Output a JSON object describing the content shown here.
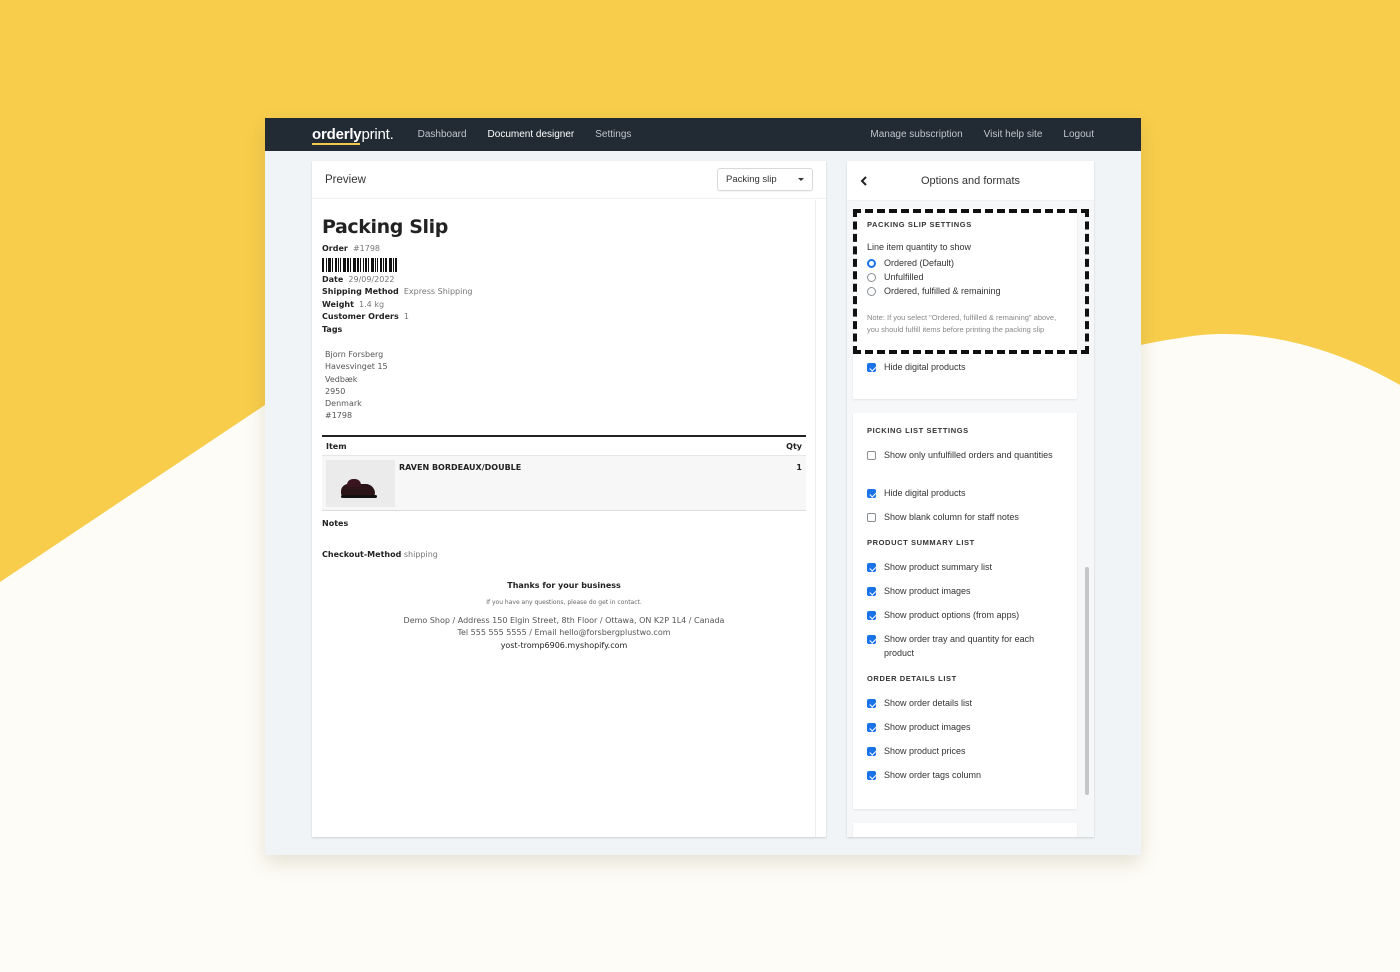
{
  "nav": {
    "logo_first": "orderly",
    "logo_second": "print.",
    "links": [
      "Dashboard",
      "Document designer",
      "Settings"
    ],
    "active_link": "Document designer",
    "right_links": [
      "Manage subscription",
      "Visit help site",
      "Logout"
    ]
  },
  "preview": {
    "title": "Preview",
    "document_type_select": "Packing slip"
  },
  "slip": {
    "heading": "Packing Slip",
    "order_label": "Order",
    "order_value": "#1798",
    "date_label": "Date",
    "date_value": "29/09/2022",
    "shipping_label": "Shipping Method",
    "shipping_value": "Express Shipping",
    "weight_label": "Weight",
    "weight_value": "1.4 kg",
    "customer_orders_label": "Customer Orders",
    "customer_orders_value": "1",
    "tags_label": "Tags",
    "address": [
      "Bjorn Forsberg",
      "Havesvinget 15",
      "Vedbæk",
      "2950",
      "Denmark",
      "#1798"
    ],
    "table_headers": {
      "item": "Item",
      "qty": "Qty"
    },
    "items": [
      {
        "name": "RAVEN BORDEAUX/DOUBLE",
        "qty": "1",
        "image": "shoe-image"
      }
    ],
    "notes_label": "Notes",
    "checkout_label": "Checkout-Method",
    "checkout_value": "shipping",
    "footer_thanks": "Thanks for your business",
    "footer_questions": "If you have any questions, please do get in contact.",
    "footer_address": "Demo Shop / Address 150 Elgin Street, 8th Floor / Ottawa, ON K2P 1L4 / Canada",
    "footer_contact": "Tel 555 555 5555 / Email hello@forsbergplustwo.com",
    "footer_domain": "yost-tromp6906.myshopify.com"
  },
  "options": {
    "title": "Options and formats",
    "packing_slip": {
      "section_title": "PACKING SLIP SETTINGS",
      "quantity_label": "Line item quantity to show",
      "radio_options": [
        {
          "label": "Ordered (Default)",
          "selected": true
        },
        {
          "label": "Unfulfilled",
          "selected": false
        },
        {
          "label": "Ordered, fulfilled & remaining",
          "selected": false
        }
      ],
      "note": "Note: If you select \"Ordered, fulfilled & remaining\" above, you should fulfill items before printing the packing slip",
      "hide_digital": {
        "label": "Hide digital products",
        "checked": true
      }
    },
    "picking_list": {
      "section_title": "PICKING LIST SETTINGS",
      "checkboxes": [
        {
          "label": "Show only unfulfilled orders and quantities",
          "checked": false
        },
        {
          "label": "Hide digital products",
          "checked": true
        },
        {
          "label": "Show blank column for staff notes",
          "checked": false
        }
      ]
    },
    "product_summary": {
      "section_title": "PRODUCT SUMMARY LIST",
      "checkboxes": [
        {
          "label": "Show product summary list",
          "checked": true
        },
        {
          "label": "Show product images",
          "checked": true
        },
        {
          "label": "Show product options (from apps)",
          "checked": true
        },
        {
          "label": "Show order tray and quantity for each product",
          "checked": true
        }
      ]
    },
    "order_details": {
      "section_title": "ORDER DETAILS LIST",
      "checkboxes": [
        {
          "label": "Show order details list",
          "checked": true
        },
        {
          "label": "Show product images",
          "checked": true
        },
        {
          "label": "Show product prices",
          "checked": true
        },
        {
          "label": "Show order tags column",
          "checked": true
        }
      ]
    }
  },
  "colors": {
    "background_yellow": "#f7cd4b",
    "background_cream": "#fdfcf6",
    "nav_bg": "#222a33",
    "accent_blue": "#1a73e8",
    "logo_underline": "#f2c94c"
  }
}
